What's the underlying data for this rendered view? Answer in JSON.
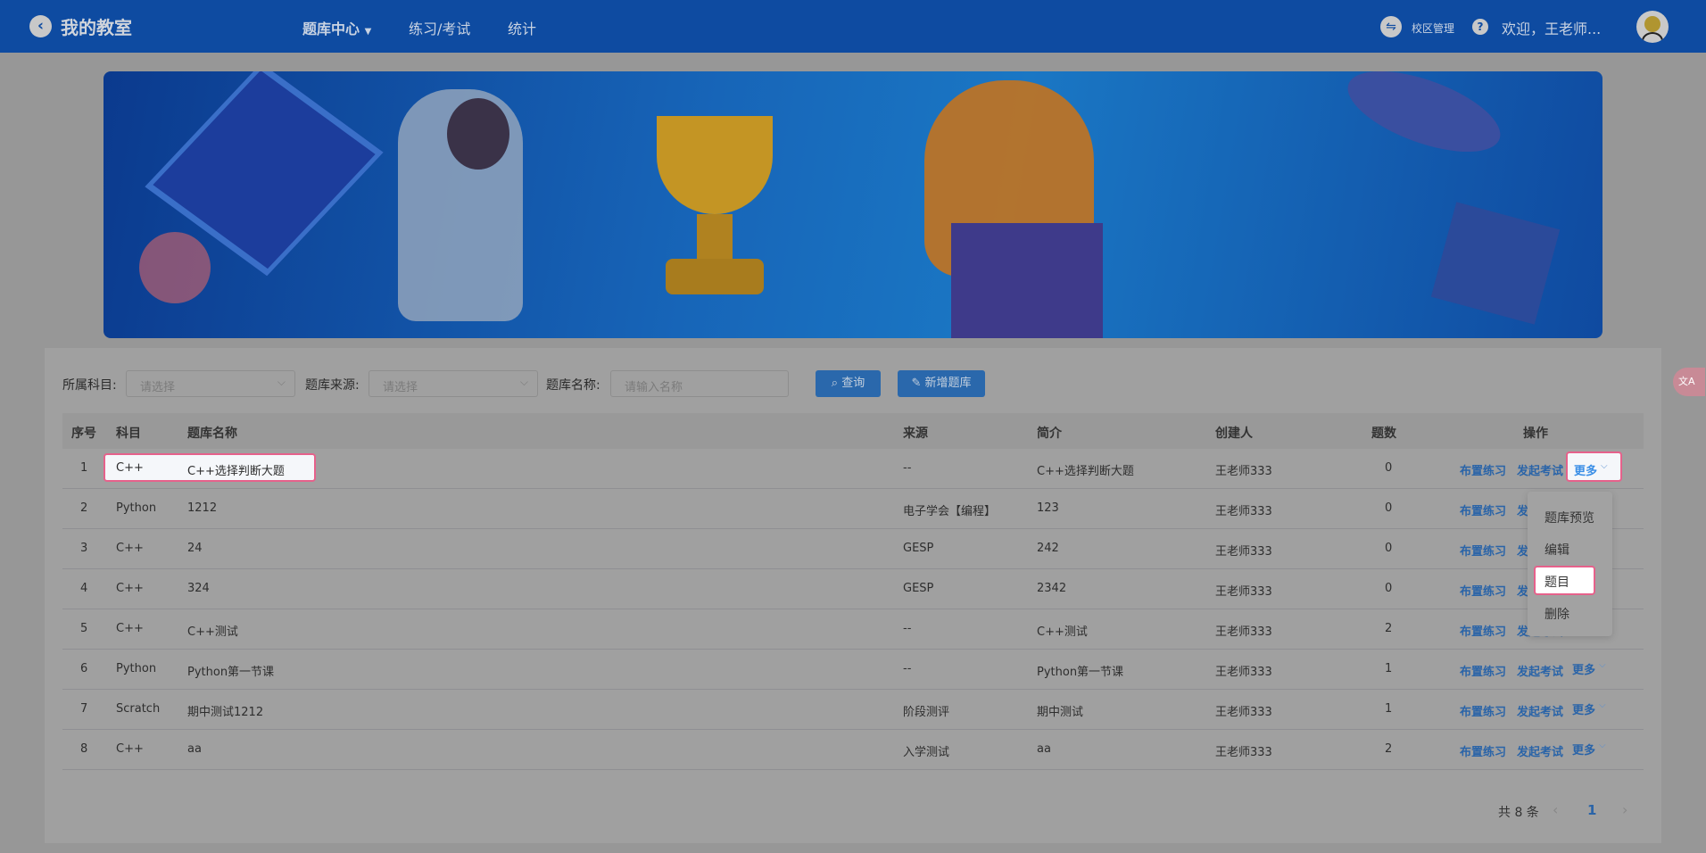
{
  "header": {
    "brand": "我的教室",
    "nav": [
      "题库中心",
      "练习/考试",
      "统计"
    ],
    "campus": "校区管理",
    "welcome": "欢迎，王老师..."
  },
  "filters": {
    "subject_label": "所属科目:",
    "subject_placeholder": "请选择",
    "source_label": "题库来源:",
    "source_placeholder": "请选择",
    "name_label": "题库名称:",
    "name_placeholder": "请输入名称",
    "query": "查询",
    "add": "新增题库"
  },
  "table": {
    "columns": [
      "序号",
      "科目",
      "题库名称",
      "来源",
      "简介",
      "创建人",
      "题数",
      "操作"
    ],
    "rows": [
      [
        "1",
        "C++",
        "C++选择判断大题",
        "--",
        "C++选择判断大题",
        "王老师333",
        "0"
      ],
      [
        "2",
        "Python",
        "1212",
        "电子学会【编程】",
        "123",
        "王老师333",
        "0"
      ],
      [
        "3",
        "C++",
        "24",
        "GESP",
        "242",
        "王老师333",
        "0"
      ],
      [
        "4",
        "C++",
        "324",
        "GESP",
        "2342",
        "王老师333",
        "0"
      ],
      [
        "5",
        "C++",
        "C++测试",
        "--",
        "C++测试",
        "王老师333",
        "2"
      ],
      [
        "6",
        "Python",
        "Python第一节课",
        "--",
        "Python第一节课",
        "王老师333",
        "1"
      ],
      [
        "7",
        "Scratch",
        "期中测试1212",
        "阶段测评",
        "期中测试",
        "王老师333",
        "1"
      ],
      [
        "8",
        "C++",
        "aa",
        "入学测试",
        "aa",
        "王老师333",
        "2"
      ]
    ],
    "actions": [
      "布置练习",
      "发起考试",
      "更多"
    ]
  },
  "dropdown": [
    "题库预览",
    "编辑",
    "题目",
    "删除"
  ],
  "pagination": {
    "total": "共 8 条",
    "page": "1"
  }
}
